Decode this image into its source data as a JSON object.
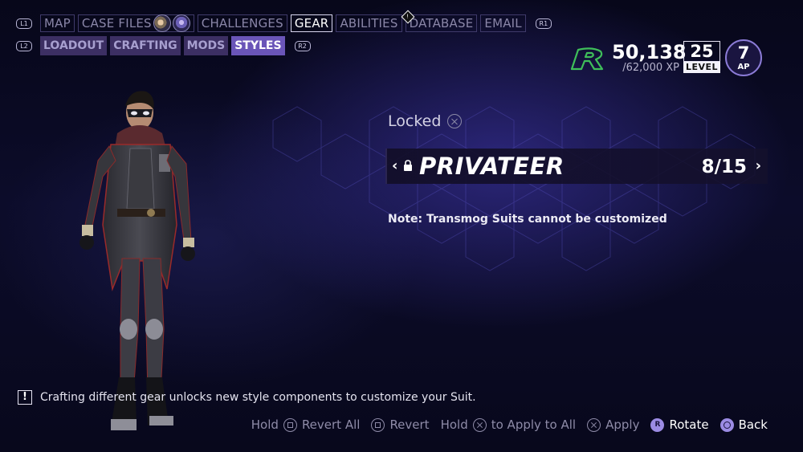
{
  "nav": {
    "l1": "L1",
    "r1": "R1",
    "l2": "L2",
    "r2": "R2",
    "tabs": [
      "MAP",
      "CASE FILES",
      "CHALLENGES",
      "GEAR",
      "ABILITIES",
      "DATABASE",
      "EMAIL"
    ],
    "active_tab": "GEAR",
    "subtabs": [
      "LOADOUT",
      "CRAFTING",
      "MODS",
      "STYLES"
    ],
    "active_subtab": "STYLES"
  },
  "stats": {
    "xp": "50,138",
    "xp_max": "/62,000 XP",
    "level": "25",
    "level_label": "LEVEL",
    "ap": "7",
    "ap_label": "AP"
  },
  "style": {
    "status": "Locked",
    "name": "PRIVATEER",
    "count": "8/15",
    "note": "Note: Transmog Suits cannot be customized"
  },
  "tip": {
    "text": "Crafting different gear unlocks new style components to customize your Suit."
  },
  "prompts": {
    "hold1": "Hold",
    "revert_all": "Revert All",
    "revert": "Revert",
    "hold2": "Hold",
    "apply_all": "to Apply to All",
    "apply": "Apply",
    "rotate": "Rotate",
    "back": "Back",
    "r_stick": "R"
  },
  "colors": {
    "accent": "#6a55b8",
    "robin_green": "#3fbf5a",
    "prompt_button": "#9b8be3"
  }
}
